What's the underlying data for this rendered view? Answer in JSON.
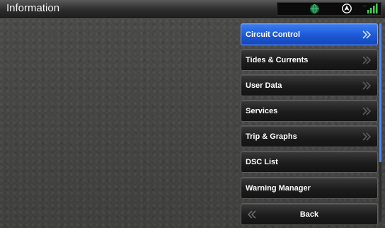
{
  "window": {
    "title": "Information"
  },
  "status_bar": {
    "icons": [
      "gps-globe-icon",
      "navigation-compass-icon",
      "signal-strength-icon"
    ],
    "signal_label": "···"
  },
  "menu": {
    "items": [
      {
        "label": "Circuit Control",
        "active": true,
        "has_chevron": true
      },
      {
        "label": "Tides & Currents",
        "active": false,
        "has_chevron": true
      },
      {
        "label": "User Data",
        "active": false,
        "has_chevron": true
      },
      {
        "label": "Services",
        "active": false,
        "has_chevron": true
      },
      {
        "label": "Trip & Graphs",
        "active": false,
        "has_chevron": true
      },
      {
        "label": "DSC List",
        "active": false,
        "has_chevron": false
      },
      {
        "label": "Warning Manager",
        "active": false,
        "has_chevron": false
      }
    ],
    "back_label": "Back"
  },
  "colors": {
    "accent": "#1d58d6",
    "title_bar": "#2e2e2e",
    "button": "#1c1c1c",
    "background": "#4a4a48",
    "gps_green": "#1a7f4a",
    "signal_green": "#3fd14a"
  }
}
